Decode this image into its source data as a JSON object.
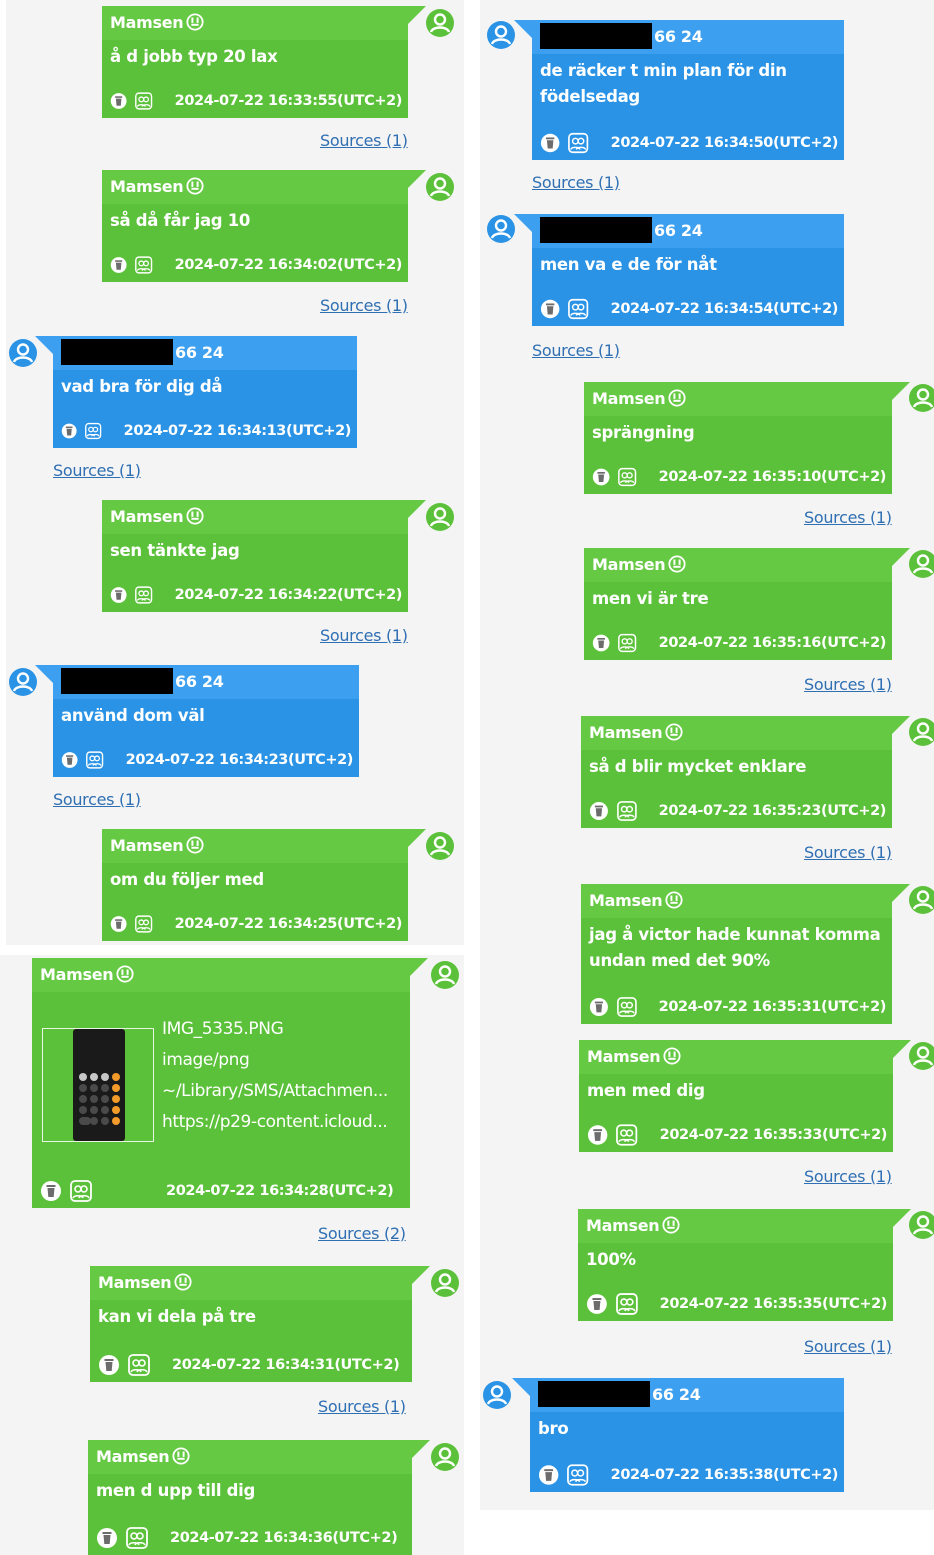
{
  "sender_green": "Mamsen",
  "sender_blue_suffix": "66 24",
  "colors": {
    "green": "#5cc13a",
    "blue": "#2a93e6",
    "link": "#2f6fb3"
  },
  "icons": {
    "trash": "trash-icon",
    "contacts": "contacts-icon",
    "avatar": "user-avatar-icon",
    "emoji": "face-badge-icon"
  },
  "messages": [
    {
      "text": "å d jobb typ 20 lax",
      "time": "2024-07-22 16:33:55(UTC+2)",
      "sources": "Sources (1)"
    },
    {
      "text": "så då får jag 10",
      "time": "2024-07-22 16:34:02(UTC+2)",
      "sources": "Sources (1)"
    },
    {
      "text": "vad bra för dig då",
      "time": "2024-07-22 16:34:13(UTC+2)",
      "sources": "Sources (1)"
    },
    {
      "text": "sen tänkte jag",
      "time": "2024-07-22 16:34:22(UTC+2)",
      "sources": "Sources (1)"
    },
    {
      "text": "använd dom väl",
      "time": "2024-07-22 16:34:23(UTC+2)",
      "sources": "Sources (1)"
    },
    {
      "text": "om du följer med",
      "time": "2024-07-22 16:34:25(UTC+2)"
    },
    {
      "attachment": {
        "name": "IMG_5335.PNG",
        "type": "image/png",
        "path": "~/Library/SMS/Attachmen...",
        "url": "https://p29-content.icloud..."
      },
      "time": "2024-07-22 16:34:28(UTC+2)",
      "sources": "Sources (2)"
    },
    {
      "text": "kan vi dela på tre",
      "time": "2024-07-22 16:34:31(UTC+2)",
      "sources": "Sources (1)"
    },
    {
      "text": "men d upp till dig",
      "time": "2024-07-22 16:34:36(UTC+2)"
    },
    {
      "text": "de räcker t min plan för din födelsedag",
      "time": "2024-07-22 16:34:50(UTC+2)",
      "sources": "Sources (1)"
    },
    {
      "text": "men va e de för nåt",
      "time": "2024-07-22 16:34:54(UTC+2)",
      "sources": "Sources (1)"
    },
    {
      "text": "sprängning",
      "time": "2024-07-22 16:35:10(UTC+2)",
      "sources": "Sources (1)"
    },
    {
      "text": "men vi är tre",
      "time": "2024-07-22 16:35:16(UTC+2)",
      "sources": "Sources (1)"
    },
    {
      "text": "så d blir mycket enklare",
      "time": "2024-07-22 16:35:23(UTC+2)",
      "sources": "Sources (1)"
    },
    {
      "text": "jag å victor hade kunnat komma undan med det 90%",
      "time": "2024-07-22 16:35:31(UTC+2)"
    },
    {
      "text": "men med dig",
      "time": "2024-07-22 16:35:33(UTC+2)",
      "sources": "Sources (1)"
    },
    {
      "text": "100%",
      "time": "2024-07-22 16:35:35(UTC+2)",
      "sources": "Sources (1)"
    },
    {
      "text": "bro",
      "time": "2024-07-22 16:35:38(UTC+2)"
    }
  ]
}
